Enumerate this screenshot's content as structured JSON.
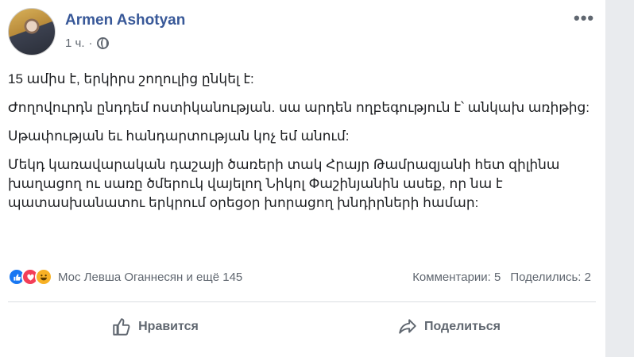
{
  "post": {
    "author": "Armen Ashotyan",
    "time": "1 ч.",
    "separator": "·",
    "more": "•••",
    "paragraphs": [
      "15 ամիս է, երկիրս շողուլից ընկել է:",
      "Ժողովուրդն ընդդեմ ոստիկանության. սա արդեն ողբեգություն է՝ անկախ առիթից:",
      "Սթափության եւ հանդարտության կոչ եմ անում:",
      "Մեկդ կառավարական դաշայի ծառերի տակ Հրայր Թամրազյանի հետ զիլինա խաղացող ու սառը ծմերուկ վայելող Նիկոլ Փաշինյանին ասեք, որ նա է պատասխանատու երկրում օրեցօր խորացող խնդիրների համար:"
    ]
  },
  "reactions": {
    "icons": [
      "like-icon",
      "love-icon",
      "haha-icon"
    ],
    "text": "Мос Левша Оганнесян и ещё 145",
    "comments": "Комментарии: 5",
    "shares": "Поделились: 2"
  },
  "actions": {
    "like_label": "Нравится",
    "share_label": "Поделиться"
  },
  "colors": {
    "author": "#385898",
    "muted": "#606770",
    "like": "#1877f2",
    "love": "#f33e58",
    "haha": "#f7b125"
  }
}
